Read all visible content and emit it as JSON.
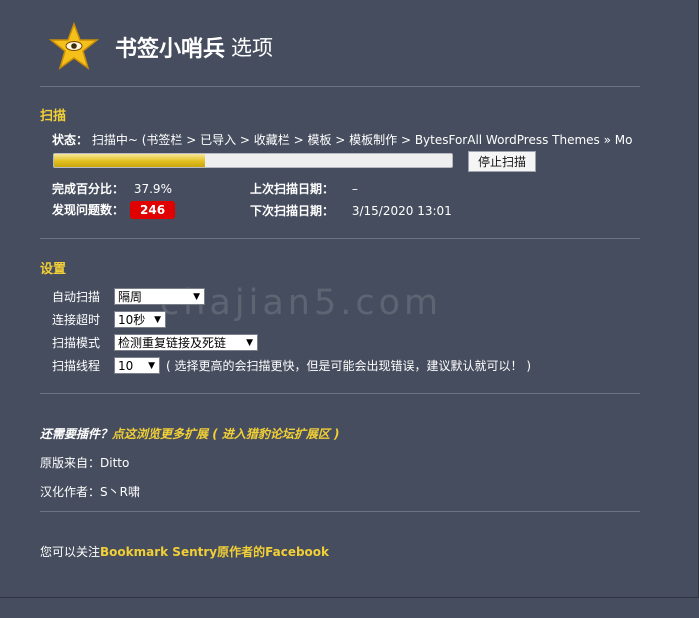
{
  "header": {
    "title_bold": "书签小哨兵",
    "title_rest": "选项",
    "icon": "star-eye-icon",
    "icon_color": "#f5c01a"
  },
  "scan": {
    "section_title": "扫描",
    "status_label": "状态：",
    "status_text": "扫描中~ (书签栏 > 已导入 > 收藏栏 > 模板 > 模板制作 > BytesForAll WordPress Themes » Monte...",
    "progress_percent": 37.9,
    "stop_button": "停止扫描",
    "percent_label": "完成百分比：",
    "percent_value": "37.9%",
    "issues_label": "发现问题数：",
    "issues_value": "246",
    "last_scan_label": "上次扫描日期：",
    "last_scan_value": "–",
    "next_scan_label": "下次扫描日期：",
    "next_scan_value": "3/15/2020 13:01"
  },
  "settings": {
    "section_title": "设置",
    "auto_scan_label": "自动扫描",
    "auto_scan_value": "隔周",
    "timeout_label": "连接超时",
    "timeout_value": "10秒",
    "mode_label": "扫描模式",
    "mode_value": "检测重复链接及死链",
    "threads_label": "扫描线程",
    "threads_value": "10",
    "threads_note": "( 选择更高的会扫描更快，但是可能会出现错误，建议默认就可以！ )"
  },
  "footer": {
    "more_question": "还需要插件？",
    "more_link": "点这浏览更多扩展 ( 进入猎豹论坛扩展区 )",
    "original_source": "原版来自：Ditto",
    "translator": "汉化作者：S丶R啸",
    "follow_prefix": "您可以关注",
    "follow_link": "Bookmark Sentry原作者的Facebook"
  },
  "watermark": "chajian5.com",
  "colors": {
    "background": "#464d5e",
    "accent": "#f1cf36",
    "badge": "#e00000"
  }
}
